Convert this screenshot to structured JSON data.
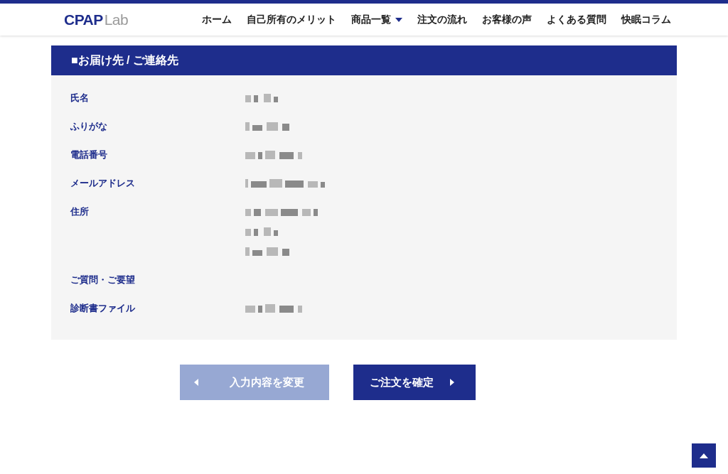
{
  "header": {
    "logo": {
      "main": "CPAP",
      "sub": "Lab"
    },
    "nav": [
      {
        "label": "ホーム",
        "dropdown": false
      },
      {
        "label": "自己所有のメリット",
        "dropdown": false
      },
      {
        "label": "商品一覧",
        "dropdown": true
      },
      {
        "label": "注文の流れ",
        "dropdown": false
      },
      {
        "label": "お客様の声",
        "dropdown": false
      },
      {
        "label": "よくある質問",
        "dropdown": false
      },
      {
        "label": "快眠コラム",
        "dropdown": false
      }
    ]
  },
  "section": {
    "title": "■お届け先 / ご連絡先",
    "rows": [
      {
        "label": "氏名",
        "values": [
          {
            "kind": "redacted"
          }
        ]
      },
      {
        "label": "ふりがな",
        "values": [
          {
            "kind": "redacted"
          }
        ]
      },
      {
        "label": "電話番号",
        "values": [
          {
            "kind": "redacted"
          }
        ]
      },
      {
        "label": "メールアドレス",
        "values": [
          {
            "kind": "redacted"
          }
        ]
      },
      {
        "label": "住所",
        "values": [
          {
            "kind": "redacted"
          },
          {
            "kind": "redacted"
          },
          {
            "kind": "redacted"
          }
        ]
      },
      {
        "label": "ご質問・ご要望",
        "values": []
      },
      {
        "label": "診断書ファイル",
        "values": [
          {
            "kind": "redacted"
          }
        ]
      }
    ]
  },
  "buttons": [
    {
      "label": "入力内容を変更",
      "kind": "back"
    },
    {
      "label": "ご注文を確定",
      "kind": "next"
    }
  ],
  "back_to_top": true
}
